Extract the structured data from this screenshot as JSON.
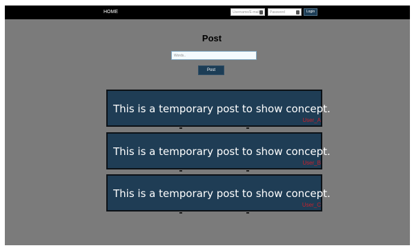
{
  "nav": {
    "home_label": "HOME",
    "username_placeholder": "Username/E-mail",
    "password_placeholder": "Password",
    "login_label": "Login"
  },
  "main": {
    "title": "Post",
    "input_placeholder": "Words..",
    "post_button_label": "Post"
  },
  "posts": [
    {
      "text": "This is a temporary post to show concept.",
      "user": "User_A"
    },
    {
      "text": "This is a temporary post to show concept.",
      "user": "User_B"
    },
    {
      "text": "This is a temporary post to show concept.",
      "user": "User_C"
    }
  ],
  "colors": {
    "page_background": "#7b7b7b",
    "navbar": "#000000",
    "accent": "#1c3d56",
    "card": "#1f3d55",
    "username": "#c8212c"
  }
}
